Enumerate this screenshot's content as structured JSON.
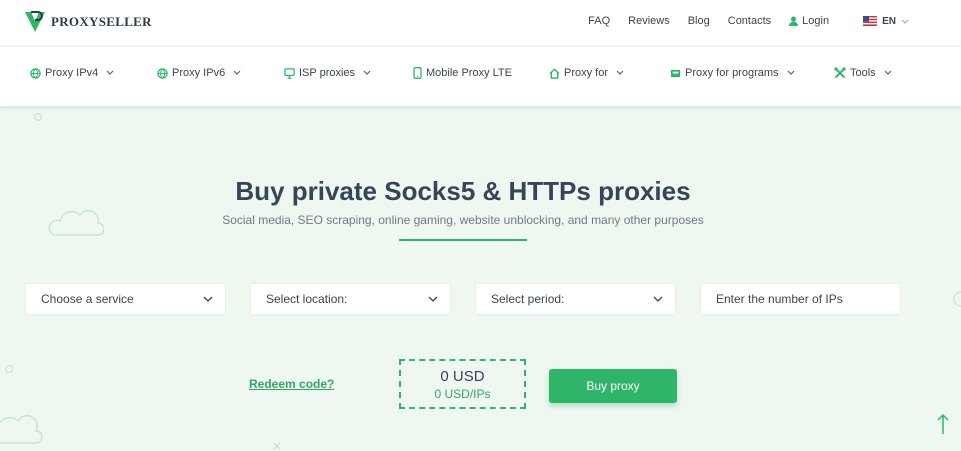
{
  "brand": {
    "name": "PROXYSELLER",
    "accent": "#2fb56a"
  },
  "topnav": {
    "links": [
      "FAQ",
      "Reviews",
      "Blog",
      "Contacts"
    ],
    "login": "Login",
    "lang": "EN"
  },
  "mainnav": {
    "items": [
      {
        "label": "Proxy IPv4",
        "icon": "globe-icon",
        "dropdown": true
      },
      {
        "label": "Proxy IPv6",
        "icon": "globe-icon",
        "dropdown": true
      },
      {
        "label": "ISP proxies",
        "icon": "monitor-icon",
        "dropdown": true
      },
      {
        "label": "Mobile Proxy LTE",
        "icon": "mobile-icon",
        "dropdown": false
      },
      {
        "label": "Proxy for",
        "icon": "home-icon",
        "dropdown": true
      },
      {
        "label": "Proxy for programs",
        "icon": "program-icon",
        "dropdown": true
      },
      {
        "label": "Tools",
        "icon": "tools-icon",
        "dropdown": true
      }
    ]
  },
  "hero": {
    "title": "Buy private Socks5 & HTTPs proxies",
    "subtitle": "Social media, SEO scraping, online gaming, website unblocking, and many other purposes"
  },
  "form": {
    "service": "Choose a service",
    "location": "Select location:",
    "period": "Select period:",
    "ips_placeholder": "Enter the number of IPs"
  },
  "checkout": {
    "redeem": "Redeem code?",
    "price": "0 USD",
    "price_per": "0 USD/IPs",
    "buy": "Buy proxy"
  }
}
